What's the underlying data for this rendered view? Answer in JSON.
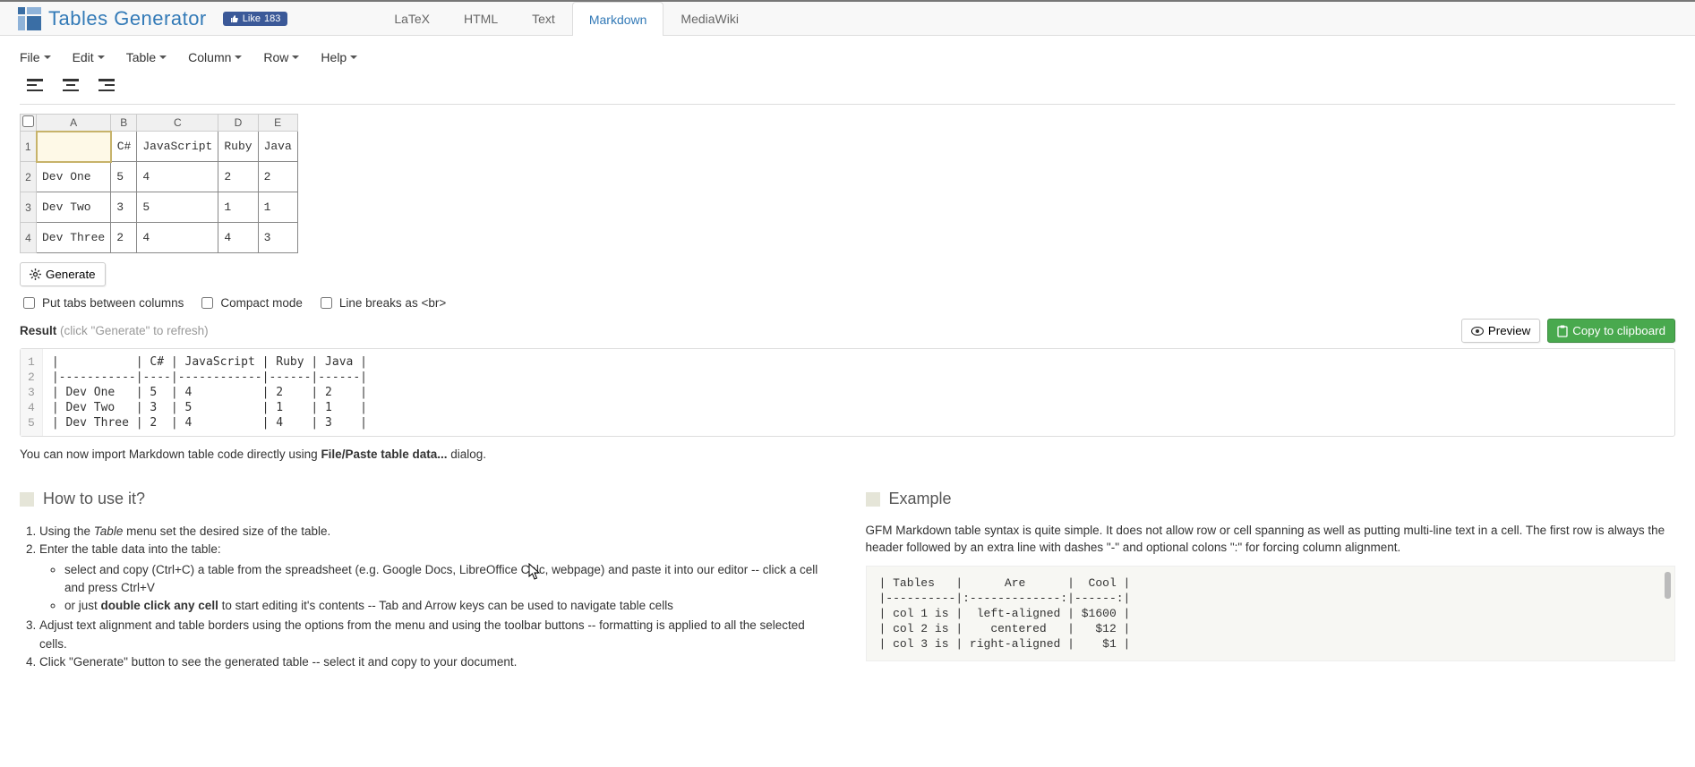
{
  "app": {
    "title": "Tables Generator"
  },
  "fblike": {
    "label": "Like",
    "count": "183"
  },
  "tabs": [
    {
      "label": "LaTeX",
      "active": false
    },
    {
      "label": "HTML",
      "active": false
    },
    {
      "label": "Text",
      "active": false
    },
    {
      "label": "Markdown",
      "active": true
    },
    {
      "label": "MediaWiki",
      "active": false
    }
  ],
  "menus": [
    "File",
    "Edit",
    "Table",
    "Column",
    "Row",
    "Help"
  ],
  "sheet": {
    "columns": [
      "A",
      "B",
      "C",
      "D",
      "E"
    ],
    "rows": [
      "1",
      "2",
      "3",
      "4"
    ],
    "cells": [
      [
        "",
        "C#",
        "JavaScript",
        "Ruby",
        "Java"
      ],
      [
        "Dev One",
        "5",
        "4",
        "2",
        "2"
      ],
      [
        "Dev Two",
        "3",
        "5",
        "1",
        "1"
      ],
      [
        "Dev Three",
        "2",
        "4",
        "4",
        "3"
      ]
    ]
  },
  "generateBtn": "Generate",
  "checks": {
    "tabs": "Put tabs between columns",
    "compact": "Compact mode",
    "breaks": "Line breaks as <br>"
  },
  "result": {
    "label": "Result",
    "hint": "(click \"Generate\" to refresh)",
    "previewBtn": "Preview",
    "copyBtn": "Copy to clipboard",
    "code": "|           | C# | JavaScript | Ruby | Java |\n|-----------|----|------------|------|------|\n| Dev One   | 5  | 4          | 2    | 2    |\n| Dev Two   | 3  | 5          | 1    | 1    |\n| Dev Three | 2  | 4          | 4    | 3    |",
    "gutter": [
      "1",
      "2",
      "3",
      "4",
      "5"
    ]
  },
  "importNote": {
    "pre": "You can now import Markdown table code directly using ",
    "strong": "File/Paste table data...",
    "post": " dialog."
  },
  "howto": {
    "title": "How to use it?",
    "items": [
      {
        "prefix": "Using the ",
        "em": "Table",
        "suffix": " menu set the desired size of the table."
      },
      {
        "text": "Enter the table data into the table:",
        "sub": [
          "select and copy (Ctrl+C) a table from the spreadsheet (e.g. Google Docs, LibreOffice Calc, webpage) and paste it into our editor -- click a cell and press Ctrl+V",
          {
            "pre": "or just ",
            "strong": "double click any cell",
            "post": " to start editing it's contents -- Tab and Arrow keys can be used to navigate table cells"
          }
        ]
      },
      {
        "text": "Adjust text alignment and table borders using the options from the menu and using the toolbar buttons -- formatting is applied to all the selected cells."
      },
      {
        "text": "Click \"Generate\" button to see the generated table -- select it and copy to your document."
      }
    ]
  },
  "example": {
    "title": "Example",
    "para": "GFM Markdown table syntax is quite simple. It does not allow row or cell spanning as well as putting multi-line text in a cell. The first row is always the header followed by an extra line with dashes \"-\" and optional colons \":\" for forcing column alignment.",
    "code": "| Tables   |      Are      |  Cool |\n|----------|:-------------:|------:|\n| col 1 is |  left-aligned | $1600 |\n| col 2 is |    centered   |   $12 |\n| col 3 is | right-aligned |    $1 |"
  },
  "chart_data": {
    "type": "table",
    "columns": [
      "",
      "C#",
      "JavaScript",
      "Ruby",
      "Java"
    ],
    "rows": [
      [
        "Dev One",
        5,
        4,
        2,
        2
      ],
      [
        "Dev Two",
        3,
        5,
        1,
        1
      ],
      [
        "Dev Three",
        2,
        4,
        4,
        3
      ]
    ]
  }
}
